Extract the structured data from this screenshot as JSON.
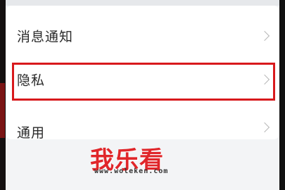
{
  "settings": {
    "items": [
      {
        "label": "消息通知"
      },
      {
        "label": "隐私"
      },
      {
        "label": "通用"
      }
    ]
  },
  "watermark": {
    "brand": "我乐看",
    "url": "www.woleken.com"
  },
  "colors": {
    "highlight_border": "#d8191c",
    "watermark_text": "#e0262a"
  }
}
